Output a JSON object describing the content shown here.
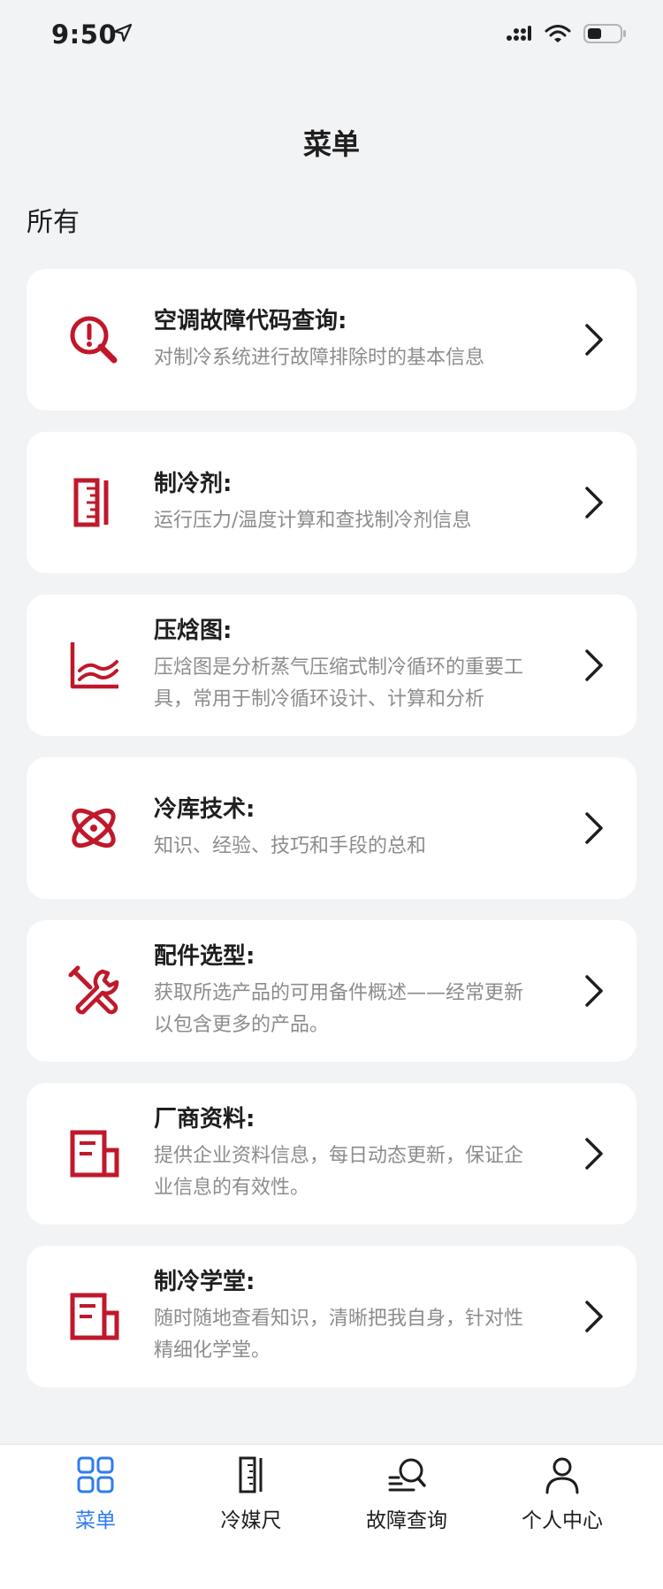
{
  "status_bar": {
    "time": "9:50"
  },
  "header": {
    "title": "菜单"
  },
  "section": {
    "title": "所有"
  },
  "colors": {
    "accent_red": "#c0182b",
    "tab_active": "#2f7bf0"
  },
  "cards": [
    {
      "icon": "search-alert-icon",
      "title": "空调故障代码查询:",
      "desc_lines": [
        "对制冷系统进行故障排除时的基本信息",
        ""
      ]
    },
    {
      "icon": "ruler-icon",
      "title": "制冷剂:",
      "desc_lines": [
        "运行压力/温度计算和查找制冷剂信息",
        ""
      ]
    },
    {
      "icon": "chart-icon",
      "title": "压焓图:",
      "desc_lines": [
        "压焓图是分析蒸气压缩式制冷循环的重要工",
        "具，常用于制冷循环设计、计算和分析"
      ]
    },
    {
      "icon": "planet-icon",
      "title": "冷库技术:",
      "desc_lines": [
        "知识、经验、技巧和手段的总和",
        ""
      ]
    },
    {
      "icon": "tools-icon",
      "title": "配件选型:",
      "desc_lines": [
        "获取所选产品的可用备件概述——经常更新",
        "以包含更多的产品。"
      ]
    },
    {
      "icon": "document-icon",
      "title": "厂商资料:",
      "desc_lines": [
        "提供企业资料信息，每日动态更新，保证企",
        "业信息的有效性。"
      ]
    },
    {
      "icon": "document-icon",
      "title": "制冷学堂:",
      "desc_lines": [
        "随时随地查看知识，清晰把我自身，针对性",
        "精细化学堂。"
      ]
    }
  ],
  "tabs": [
    {
      "icon": "grid-icon",
      "label": "菜单",
      "active": true
    },
    {
      "icon": "ruler-icon",
      "label": "冷媒尺",
      "active": false
    },
    {
      "icon": "search-list-icon",
      "label": "故障查询",
      "active": false
    },
    {
      "icon": "person-icon",
      "label": "个人中心",
      "active": false
    }
  ]
}
